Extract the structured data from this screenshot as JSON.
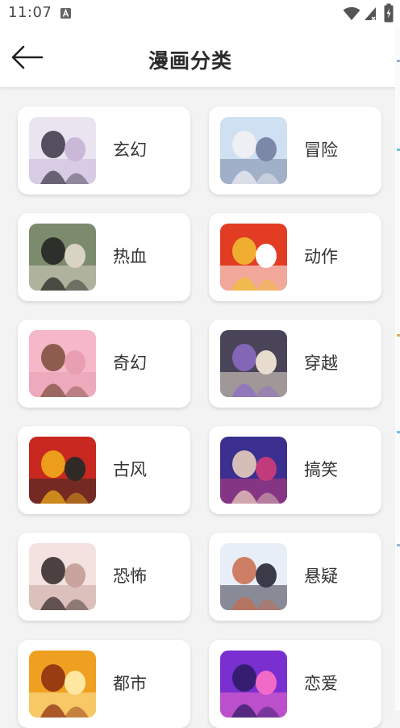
{
  "status_bar": {
    "time": "11:07",
    "icons": [
      "accessibility-a-icon",
      "wifi-icon",
      "cell-signal-icon",
      "battery-charging-icon"
    ]
  },
  "header": {
    "title": "漫画分类",
    "back_icon": "arrow-left-icon"
  },
  "categories": [
    {
      "label": "玄幻",
      "thumb_colors": [
        "#e9e4ef",
        "#3a3444",
        "#c9b8d8"
      ]
    },
    {
      "label": "冒险",
      "thumb_colors": [
        "#cfe0f2",
        "#f4f2f5",
        "#7b88a8"
      ]
    },
    {
      "label": "热血",
      "thumb_colors": [
        "#7c8a6e",
        "#1f1f1f",
        "#d9d3c4"
      ]
    },
    {
      "label": "动作",
      "thumb_colors": [
        "#e23d22",
        "#f1c232",
        "#ffffff"
      ]
    },
    {
      "label": "奇幻",
      "thumb_colors": [
        "#f6b8c9",
        "#7a4b3a",
        "#e89fb2"
      ]
    },
    {
      "label": "穿越",
      "thumb_colors": [
        "#4a4458",
        "#8d6cc7",
        "#e8dccf"
      ]
    },
    {
      "label": "古风",
      "thumb_colors": [
        "#c8281f",
        "#f2b21a",
        "#2f2a26"
      ]
    },
    {
      "label": "搞笑",
      "thumb_colors": [
        "#3b2f8f",
        "#f2d7c0",
        "#c13b7a"
      ]
    },
    {
      "label": "恐怖",
      "thumb_colors": [
        "#f3e2df",
        "#2e2424",
        "#c8a49c"
      ]
    },
    {
      "label": "悬疑",
      "thumb_colors": [
        "#e7eef7",
        "#c96a4a",
        "#3a3a48"
      ]
    },
    {
      "label": "都市",
      "thumb_colors": [
        "#f0a020",
        "#8a2a10",
        "#ffe7a0"
      ]
    },
    {
      "label": "恋爱",
      "thumb_colors": [
        "#7a2fd0",
        "#2a1a60",
        "#f26ac8"
      ]
    }
  ]
}
